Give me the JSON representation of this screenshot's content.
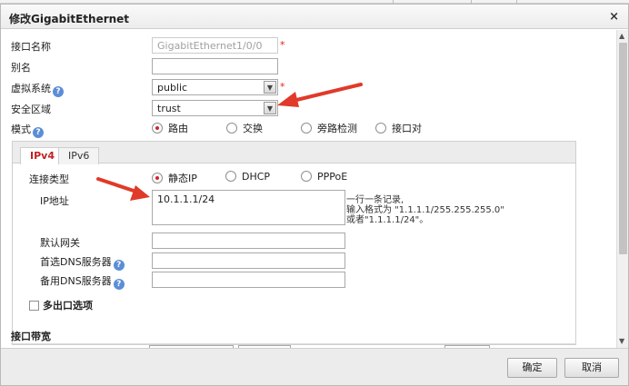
{
  "dialog": {
    "title": "修改GigabitEthernet",
    "close_glyph": "×"
  },
  "form": {
    "interface_name": {
      "label": "接口名称",
      "value": "GigabitEthernet1/0/0",
      "required_mark": "*"
    },
    "alias": {
      "label": "别名",
      "value": ""
    },
    "virtual_system": {
      "label": "虚拟系统",
      "value": "public",
      "required_mark": "*",
      "help": "?"
    },
    "security_zone": {
      "label": "安全区域",
      "value": "trust"
    },
    "mode": {
      "label": "模式",
      "help": "?",
      "options": [
        "路由",
        "交换",
        "旁路检测",
        "接口对"
      ],
      "selected": "路由"
    }
  },
  "tabs": [
    {
      "label": "IPv4",
      "active": true
    },
    {
      "label": "IPv6",
      "active": false
    }
  ],
  "ipv4": {
    "connection_type": {
      "label": "连接类型",
      "options": [
        "静态IP",
        "DHCP",
        "PPPoE"
      ],
      "selected": "静态IP"
    },
    "ip_address": {
      "label": "IP地址",
      "value": "10.1.1.1/24",
      "hint_line1": "一行一条记录,",
      "hint_line2": "输入格式为 \"1.1.1.1/255.255.255.0\"",
      "hint_line3": "或者\"1.1.1.1/24\"。"
    },
    "default_gateway": {
      "label": "默认网关",
      "value": ""
    },
    "primary_dns": {
      "label": "首选DNS服务器",
      "value": "",
      "help": "?"
    },
    "secondary_dns": {
      "label": "备用DNS服务器",
      "value": "",
      "help": "?"
    },
    "multi_exit": {
      "label": "多出口选项"
    }
  },
  "bandwidth": {
    "title": "接口带宽"
  },
  "footer": {
    "ok_label": "确定",
    "cancel_label": "取消"
  },
  "colors": {
    "accent_red": "#c32022",
    "arrow_red": "#e03a2a",
    "help_blue": "#5b8ed6"
  }
}
